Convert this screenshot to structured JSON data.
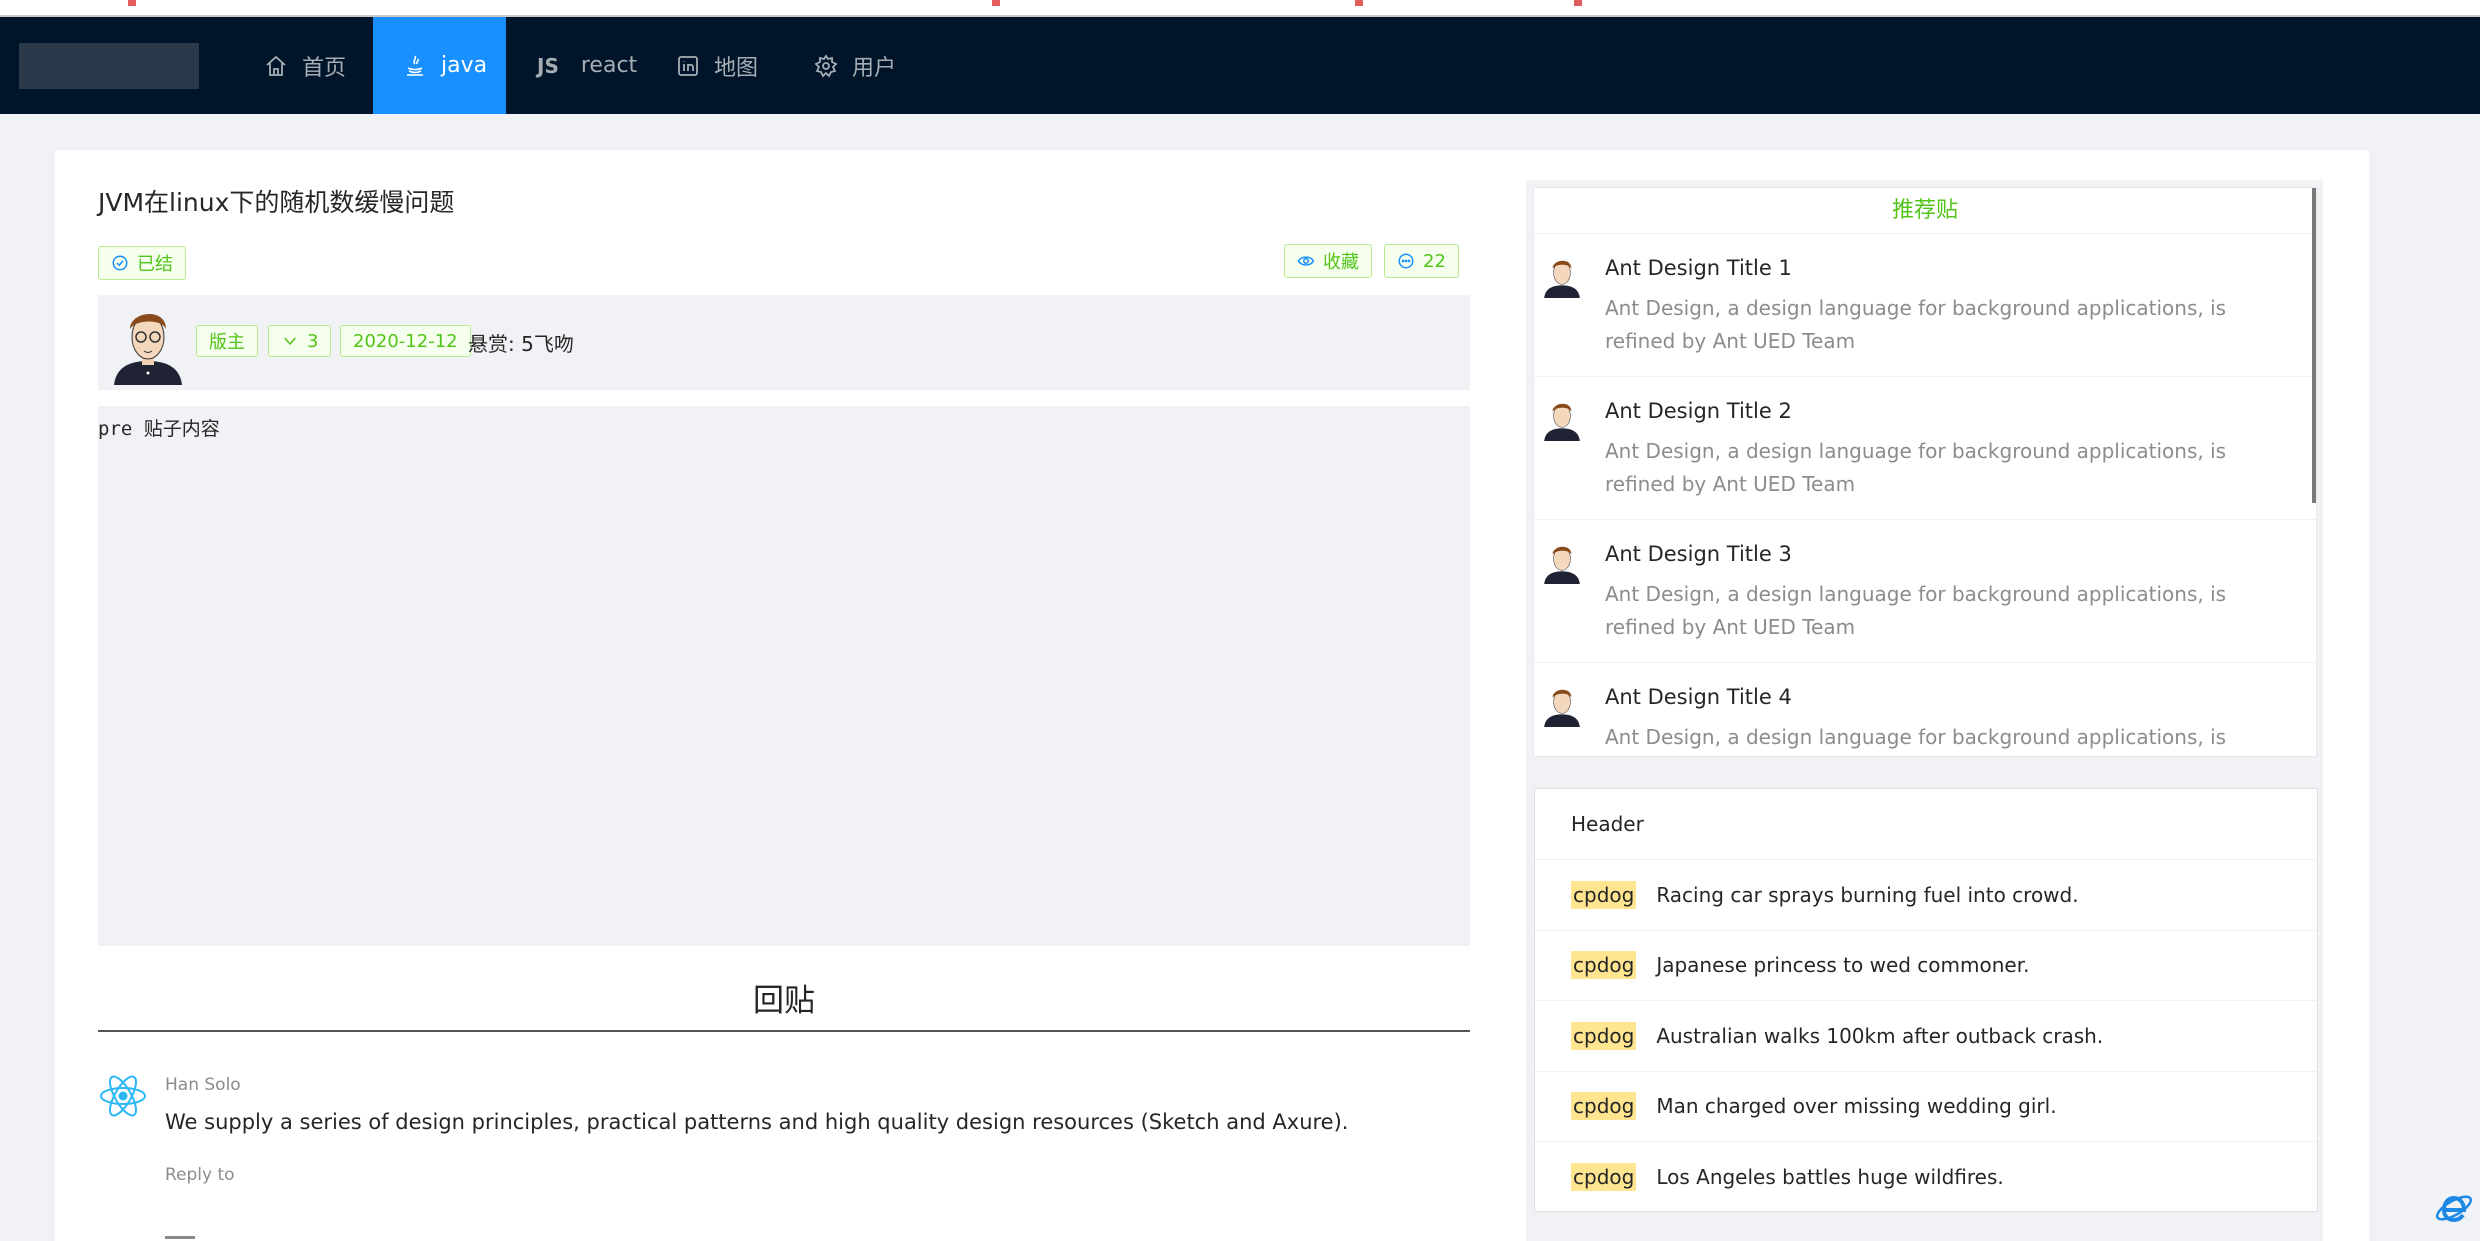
{
  "nav": {
    "items": [
      {
        "label": "首页",
        "icon": "home-icon"
      },
      {
        "label": "java",
        "icon": "java-icon"
      },
      {
        "label": "react",
        "icon": "js-icon"
      },
      {
        "label": "地图",
        "icon": "linkedin-icon"
      },
      {
        "label": "用户",
        "icon": "setting-icon"
      }
    ],
    "js_glyph": "JS",
    "active": "java",
    "active_color": "#1890ff",
    "bar_color": "#001529"
  },
  "post": {
    "title": "JVM在linux下的随机数缓慢问题",
    "status_tag": "已结",
    "favorite_tag": "收藏",
    "comment_count": "22",
    "author_role": "版主",
    "vote_count": "3",
    "date": "2020-12-12",
    "reward": "悬赏: 5飞吻",
    "body": "pre 贴子内容"
  },
  "replies": {
    "heading": "回贴",
    "comments": [
      {
        "author": "Han Solo",
        "text": "We supply a series of design principles, practical patterns and high quality design resources (Sketch and Axure).",
        "action": "Reply to"
      }
    ]
  },
  "recommend": {
    "header": "推荐贴",
    "items": [
      {
        "title": "Ant Design Title 1",
        "desc": "Ant Design, a design language for background applications, is refined by Ant UED Team"
      },
      {
        "title": "Ant Design Title 2",
        "desc": "Ant Design, a design language for background applications, is refined by Ant UED Team"
      },
      {
        "title": "Ant Design Title 3",
        "desc": "Ant Design, a design language for background applications, is refined by Ant UED Team"
      },
      {
        "title": "Ant Design Title 4",
        "desc": "Ant Design, a design language for background applications, is refined by Ant UED Team"
      }
    ]
  },
  "news": {
    "header": "Header",
    "items": [
      {
        "mark": "cpdog",
        "text": "Racing car sprays burning fuel into crowd."
      },
      {
        "mark": "cpdog",
        "text": "Japanese princess to wed commoner."
      },
      {
        "mark": "cpdog",
        "text": "Australian walks 100km after outback crash."
      },
      {
        "mark": "cpdog",
        "text": "Man charged over missing wedding girl."
      },
      {
        "mark": "cpdog",
        "text": "Los Angeles battles huge wildfires."
      }
    ]
  },
  "colors": {
    "tag_green": "#52c41a",
    "highlight": "#ffe58f"
  }
}
